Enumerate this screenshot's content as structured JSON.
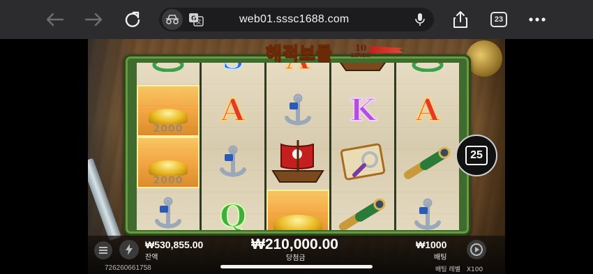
{
  "browser": {
    "url": "web01.sssc1688.com",
    "tab_count": "23",
    "icons": [
      "back-arrow-icon",
      "forward-arrow-icon",
      "reload-icon",
      "privacy-icon",
      "translate-icon",
      "microphone-icon",
      "share-icon",
      "tabs-icon",
      "more-icon"
    ]
  },
  "game": {
    "title": "해적보물",
    "lines_badge_number": "10",
    "lines_badge_word": "LINES",
    "autospin_count": "25",
    "reels": [
      [
        {
          "symbol": "partial",
          "label": ""
        },
        {
          "symbol": "gold",
          "label": "2000"
        },
        {
          "symbol": "gold",
          "label": "2000"
        },
        {
          "symbol": "anchor",
          "label": ""
        }
      ],
      [
        {
          "symbol": "letter-s",
          "label": "S"
        },
        {
          "symbol": "letter-a",
          "label": "A"
        },
        {
          "symbol": "anchor",
          "label": ""
        },
        {
          "symbol": "letter-q",
          "label": "Q"
        }
      ],
      [
        {
          "symbol": "letter-a",
          "label": "A"
        },
        {
          "symbol": "anchor",
          "label": ""
        },
        {
          "symbol": "ship",
          "label": ""
        },
        {
          "symbol": "gold",
          "label": ""
        }
      ],
      [
        {
          "symbol": "ship",
          "label": ""
        },
        {
          "symbol": "letter-k",
          "label": "K"
        },
        {
          "symbol": "map",
          "label": ""
        },
        {
          "symbol": "spyglass",
          "label": ""
        }
      ],
      [
        {
          "symbol": "partial",
          "label": ""
        },
        {
          "symbol": "letter-a",
          "label": "A"
        },
        {
          "symbol": "spyglass",
          "label": ""
        },
        {
          "symbol": "anchor",
          "label": ""
        }
      ]
    ]
  },
  "footer": {
    "balance_value": "₩530,855.00",
    "balance_label": "잔액",
    "win_value": "₩210,000.00",
    "win_label": "당첨금",
    "bet_value": "₩1000",
    "bet_label": "배팅",
    "session_id": "726260661758",
    "bet_level_label": "배팅 레벨",
    "bet_level_value": "X100"
  }
}
